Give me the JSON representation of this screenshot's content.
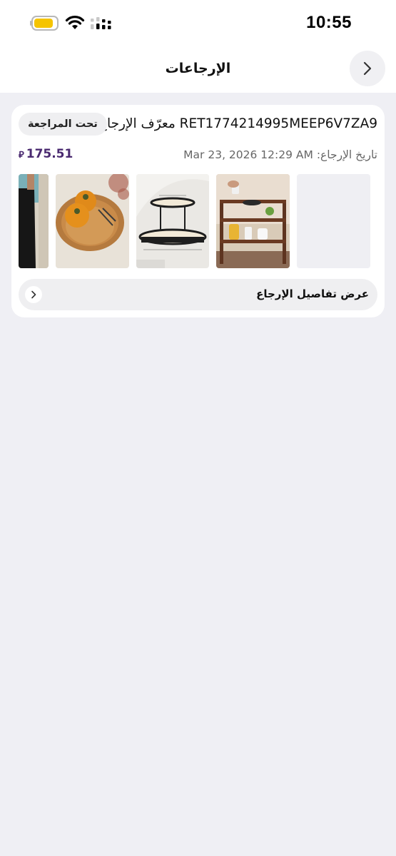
{
  "status_bar": {
    "time": "10:55",
    "icons": [
      "battery-icon",
      "wifi-icon",
      "cellular-signal-icon"
    ],
    "battery_color": "#f5c400"
  },
  "header": {
    "title": "الإرجاعات",
    "back_icon": "chevron-right-icon"
  },
  "returns": [
    {
      "id_label": "معرّف الإرجاع:",
      "id_value": "RET1774214995MEEP6V7ZA9",
      "status": "تحت المراجعة",
      "date_label": "تاريخ الإرجاع:",
      "date_value": "Mar 23, 2026 12:29 AM",
      "amount": "175.51",
      "currency_symbol": "⃁",
      "amount_color": "#4a2a70",
      "items": [
        {
          "icon": "product-image-placeholder"
        },
        {
          "icon": "wooden-spice-rack-image"
        },
        {
          "icon": "two-tier-tray-image"
        },
        {
          "icon": "rattan-tray-persimmons-image"
        },
        {
          "icon": "black-pants-image"
        }
      ],
      "view_details_label": "عرض تفاصيل الإرجاع",
      "view_details_icon": "chevron-right-icon"
    }
  ]
}
